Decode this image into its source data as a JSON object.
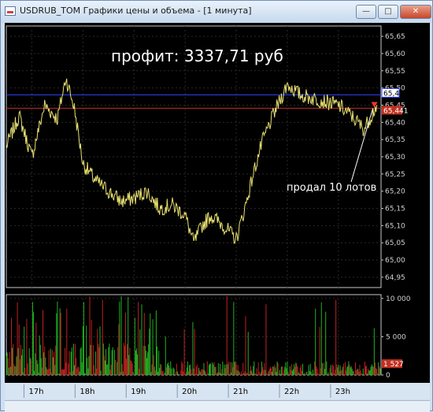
{
  "window": {
    "title": "USDRUB_TOM Графики цены и объема - [1 минута]",
    "minimize_icon": "minimize-icon",
    "maximize_icon": "maximize-icon",
    "close_icon": "close-icon"
  },
  "annotations": {
    "profit_text": "профит:   3337,71 руб",
    "sold_text": "продал 10 лотов"
  },
  "price_axis": {
    "ticks": [
      "65,65",
      "65,60",
      "65,55",
      "65,50",
      "65,45",
      "65,40",
      "65,35",
      "65,30",
      "65,25",
      "65,20",
      "65,15",
      "65,10",
      "65,05",
      "65,00",
      "64,95"
    ],
    "blue_line_label": "65,48",
    "red_line_label": "65,441"
  },
  "volume_axis": {
    "ticks": [
      "10 000",
      "5 000",
      "0"
    ],
    "current_label": "1 527"
  },
  "time_axis": {
    "ticks": [
      "17h",
      "18h",
      "19h",
      "20h",
      "21h",
      "22h",
      "23h"
    ]
  },
  "colors": {
    "price_line": "#e8e070",
    "blue_level": "#3040ff",
    "red_level": "#c03020",
    "volume_up": "#22b022",
    "volume_down": "#c02020",
    "background": "#000000"
  },
  "chart_data": {
    "type": "line",
    "x_range": [
      "16:30",
      "23:50"
    ],
    "price_ylim": [
      64.92,
      65.68
    ],
    "price_levels": {
      "blue": 65.48,
      "red": 65.441
    },
    "price_keypoints": [
      [
        "16:30",
        65.33
      ],
      [
        "16:45",
        65.42
      ],
      [
        "17:00",
        65.3
      ],
      [
        "17:15",
        65.45
      ],
      [
        "17:30",
        65.41
      ],
      [
        "17:40",
        65.53
      ],
      [
        "17:50",
        65.44
      ],
      [
        "18:00",
        65.28
      ],
      [
        "18:15",
        65.23
      ],
      [
        "18:30",
        65.2
      ],
      [
        "18:45",
        65.17
      ],
      [
        "19:00",
        65.18
      ],
      [
        "19:15",
        65.2
      ],
      [
        "19:30",
        65.15
      ],
      [
        "19:45",
        65.16
      ],
      [
        "20:00",
        65.13
      ],
      [
        "20:10",
        65.05
      ],
      [
        "20:20",
        65.1
      ],
      [
        "20:30",
        65.13
      ],
      [
        "20:45",
        65.1
      ],
      [
        "21:00",
        65.06
      ],
      [
        "21:10",
        65.15
      ],
      [
        "21:20",
        65.25
      ],
      [
        "21:30",
        65.34
      ],
      [
        "21:45",
        65.43
      ],
      [
        "22:00",
        65.51
      ],
      [
        "22:15",
        65.48
      ],
      [
        "22:30",
        65.47
      ],
      [
        "22:45",
        65.46
      ],
      [
        "23:00",
        65.45
      ],
      [
        "23:15",
        65.42
      ],
      [
        "23:30",
        65.38
      ],
      [
        "23:45",
        65.45
      ]
    ],
    "volume_ylim": [
      0,
      10500
    ],
    "volume_last": 1527
  }
}
